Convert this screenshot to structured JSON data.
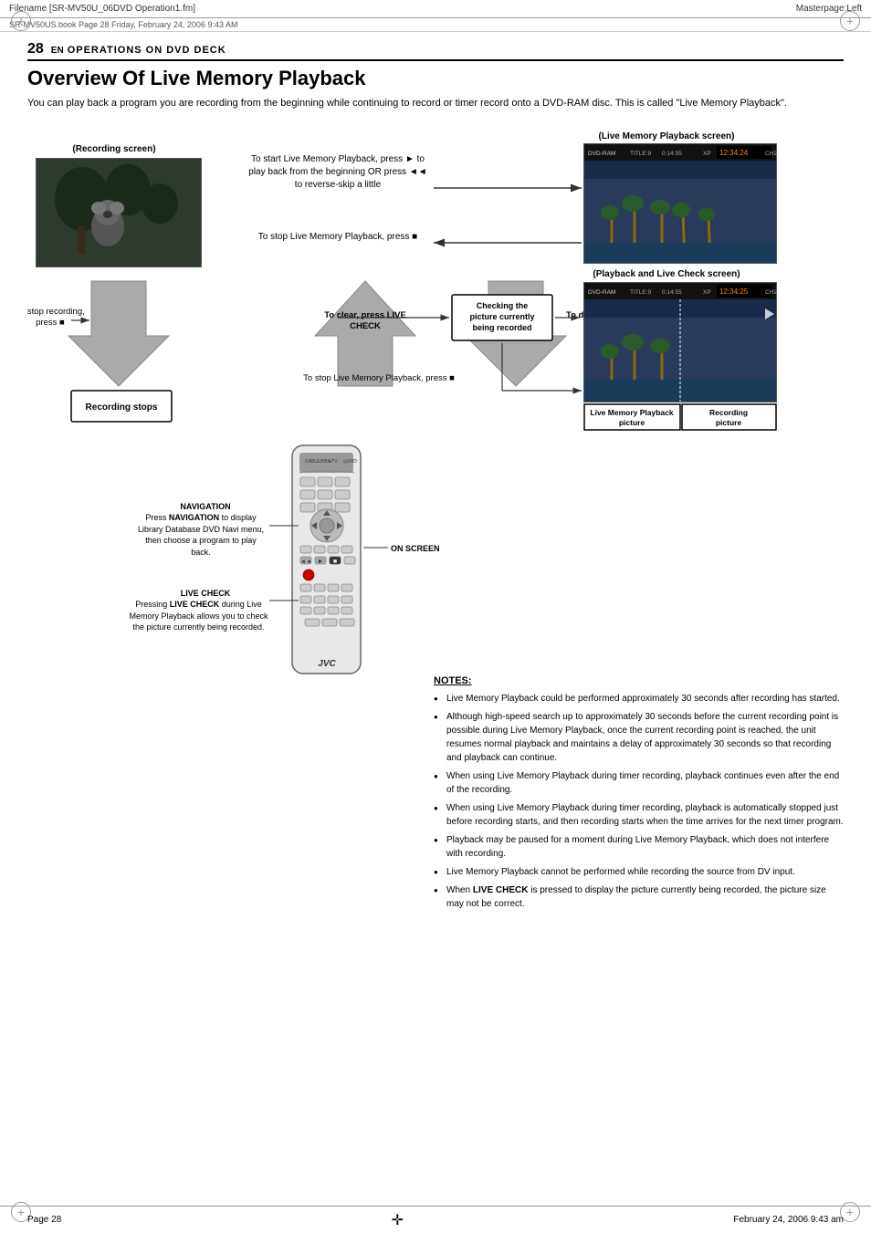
{
  "header": {
    "filename": "Filename [SR-MV50U_06DVD Operation1.fm]",
    "masterpage": "Masterpage:Left",
    "subheader": "SR-MV50US.book  Page 28  Friday, February 24, 2006  9:43 AM"
  },
  "page": {
    "number": "28",
    "en_label": "EN",
    "section": "OPERATIONS ON DVD DECK",
    "title": "Overview Of Live Memory Playback",
    "intro": "You can play back a program you are recording from the beginning while continuing to record or timer record onto a DVD-RAM disc. This is called \"Live Memory Playback\"."
  },
  "diagram": {
    "recording_screen_label": "(Recording screen)",
    "live_screen_label": "(Live Memory Playback screen)",
    "playback_check_label": "(Playback and Live Check screen)",
    "callout_start": "To start Live Memory Playback, press ► to play back from the beginning OR press ◄◄ to reverse-skip a little",
    "callout_stop_playback_1": "To stop Live Memory Playback, press ■",
    "callout_stop_recording": "To stop recording, press ■",
    "callout_clear": "To clear, press LIVE CHECK",
    "callout_stop_playback_2": "To stop Live Memory Playback, press ■",
    "callout_display": "To display, press LIVE CHECK",
    "recording_stops_label": "Recording stops",
    "checking_label": "Checking the picture currently being recorded",
    "live_memory_playback_picture": "Live Memory Playback picture",
    "recording_picture": "Recording picture"
  },
  "remote": {
    "navigation_label": "NAVIGATION",
    "navigation_desc": "Press NAVIGATION to display Library Database DVD Navi menu, then choose a program to play back.\n(☞ pg. 51)",
    "on_screen_label": "ON SCREEN",
    "live_check_label": "LIVE CHECK",
    "live_check_desc": "Pressing LIVE CHECK during Live Memory Playback allows you to check the picture currently being recorded."
  },
  "notes": {
    "title": "NOTES:",
    "items": [
      "Live Memory Playback could be performed approximately 30 seconds after recording has started.",
      "Although high-speed search up to approximately 30 seconds before the current recording point is possible during Live Memory Playback, once the current recording point is reached, the unit resumes normal playback and maintains a delay of approximately 30 seconds so that recording and playback can continue.",
      "When using Live Memory Playback during timer recording, playback continues even after the end of the recording.",
      "When using Live Memory Playback during timer recording, playback is automatically stopped just before recording starts, and then recording starts when the time arrives for the next timer program.",
      "Playback may be paused for a moment during Live Memory Playback, which does not interfere with recording.",
      "Live Memory Playback cannot be performed while recording the source from DV input.",
      "When LIVE CHECK is pressed to display the picture currently being recorded, the picture size may not be correct."
    ]
  },
  "footer": {
    "page_label": "Page 28",
    "date_label": "February 24, 2006 9:43 am"
  }
}
